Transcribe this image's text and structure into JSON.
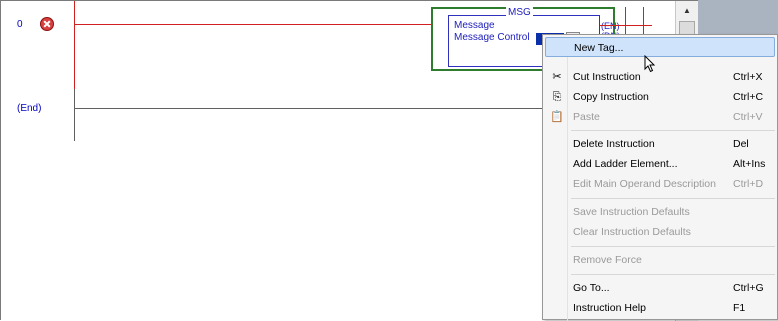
{
  "rungs": [
    {
      "number": "0"
    },
    {
      "number": "(End)"
    }
  ],
  "instruction": {
    "name": "MSG",
    "row1_label": "Message",
    "row2_label": "Message Control",
    "output_en": "EN",
    "output_dn": "DN"
  },
  "context_menu": {
    "items": [
      {
        "label": "New Tag...",
        "shortcut": "",
        "state": "highlighted",
        "icon": ""
      },
      {
        "label": "Cut Instruction",
        "shortcut": "Ctrl+X",
        "state": "enabled",
        "icon": "scissors-icon"
      },
      {
        "label": "Copy Instruction",
        "shortcut": "Ctrl+C",
        "state": "enabled",
        "icon": "copy-icon"
      },
      {
        "label": "Paste",
        "shortcut": "Ctrl+V",
        "state": "disabled",
        "icon": "paste-icon"
      },
      {
        "label": "Delete Instruction",
        "shortcut": "Del",
        "state": "enabled",
        "icon": ""
      },
      {
        "label": "Add Ladder Element...",
        "shortcut": "Alt+Ins",
        "state": "enabled",
        "icon": ""
      },
      {
        "label": "Edit Main Operand Description",
        "shortcut": "Ctrl+D",
        "state": "disabled",
        "icon": ""
      },
      {
        "label": "Save Instruction Defaults",
        "shortcut": "",
        "state": "disabled",
        "icon": ""
      },
      {
        "label": "Clear Instruction Defaults",
        "shortcut": "",
        "state": "disabled",
        "icon": ""
      },
      {
        "label": "Remove Force",
        "shortcut": "",
        "state": "disabled",
        "icon": ""
      },
      {
        "label": "Go To...",
        "shortcut": "Ctrl+G",
        "state": "enabled",
        "icon": ""
      },
      {
        "label": "Instruction Help",
        "shortcut": "F1",
        "state": "enabled",
        "icon": ""
      }
    ]
  },
  "colors": {
    "rung_error": "#d02020",
    "instruction_text": "#2020c0",
    "instruction_border": "#2e7d2e",
    "menu_highlight": "#cfe3fa"
  }
}
